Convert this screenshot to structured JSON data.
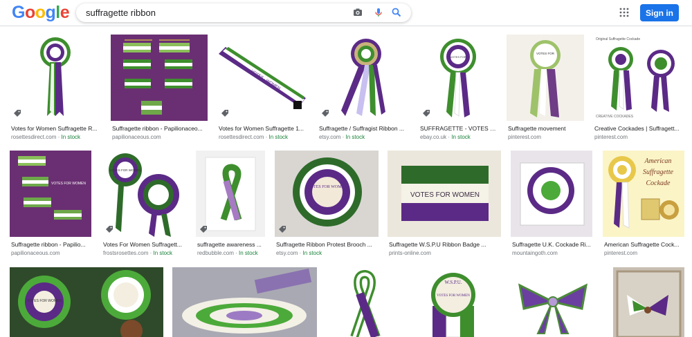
{
  "header": {
    "logo_letters": [
      {
        "ch": "G",
        "color": "#4285f4"
      },
      {
        "ch": "o",
        "color": "#ea4335"
      },
      {
        "ch": "o",
        "color": "#fbbc05"
      },
      {
        "ch": "g",
        "color": "#4285f4"
      },
      {
        "ch": "l",
        "color": "#34a853"
      },
      {
        "ch": "e",
        "color": "#ea4335"
      }
    ],
    "search_value": "suffragette ribbon",
    "signin_label": "Sign in"
  },
  "results": [
    {
      "title": "Votes for Women Suffragette R...",
      "source": "rosettesdirect.com",
      "stock": "In stock"
    },
    {
      "title": "Suffragette ribbon - Papilionaceo...",
      "source": "papilionaceous.com",
      "stock": ""
    },
    {
      "title": "Votes for Women Suffragette 1...",
      "source": "rosettesdirect.com",
      "stock": "In stock"
    },
    {
      "title": "Suffragette / Suffragist Ribbon ...",
      "source": "etsy.com",
      "stock": "In stock"
    },
    {
      "title": "SUFFRAGETTE - VOTES F...",
      "source": "ebay.co.uk",
      "stock": "In stock"
    },
    {
      "title": "Suffragette movement",
      "source": "pinterest.com",
      "stock": ""
    },
    {
      "title": "Creative Cockades | Suffragett...",
      "source": "pinterest.com",
      "stock": ""
    },
    {
      "title": "Suffragette ribbon - Papilio...",
      "source": "papilionaceous.com",
      "stock": ""
    },
    {
      "title": "Votes For Women Suffragett...",
      "source": "frostsrosettes.com",
      "stock": "In stock"
    },
    {
      "title": "suffragette awareness ...",
      "source": "redbubble.com",
      "stock": "In stock"
    },
    {
      "title": "Suffragette Ribbon Protest Brooch ...",
      "source": "etsy.com",
      "stock": "In stock"
    },
    {
      "title": "Suffragette W.S.P.U Ribbon Badge ...",
      "source": "prints-online.com",
      "stock": ""
    },
    {
      "title": "Suffragette U.K. Cockade Ri...",
      "source": "mountaingoth.com",
      "stock": ""
    },
    {
      "title": "American Suffragette Cock...",
      "source": "pinterest.com",
      "stock": ""
    },
    {
      "title": "",
      "source": "",
      "stock": ""
    },
    {
      "title": "",
      "source": "",
      "stock": ""
    },
    {
      "title": "",
      "source": "",
      "stock": ""
    },
    {
      "title": "",
      "source": "",
      "stock": ""
    },
    {
      "title": "",
      "source": "",
      "stock": ""
    },
    {
      "title": "",
      "source": "",
      "stock": ""
    }
  ],
  "image_text": {
    "r1_3": "VOTES · WOMEN",
    "r1_5": "VOTES FOR",
    "r1_6": "VOTES FOR",
    "r1_7a": "Original Suffragette Cockade",
    "r1_7b": "CREATIVE COCKADES",
    "r2_2": "VOTES FOR WOMEN",
    "r2_4": "VOTES FOR WOMEN",
    "r2_5": "VOTES FOR WOMEN",
    "r2_7a": "American",
    "r2_7b": "Suffragette",
    "r2_7c": "Cockade",
    "r3_4a": "W.S.P.U.",
    "r3_4b": "VOTES FOR WOMEN",
    "r3_1": "VOTES FOR WOMEN"
  },
  "colors": {
    "purple": "#5b2a86",
    "green": "#3e8e2e",
    "white": "#ffffff",
    "accent": "#1a73e8",
    "in_stock": "#188038"
  }
}
